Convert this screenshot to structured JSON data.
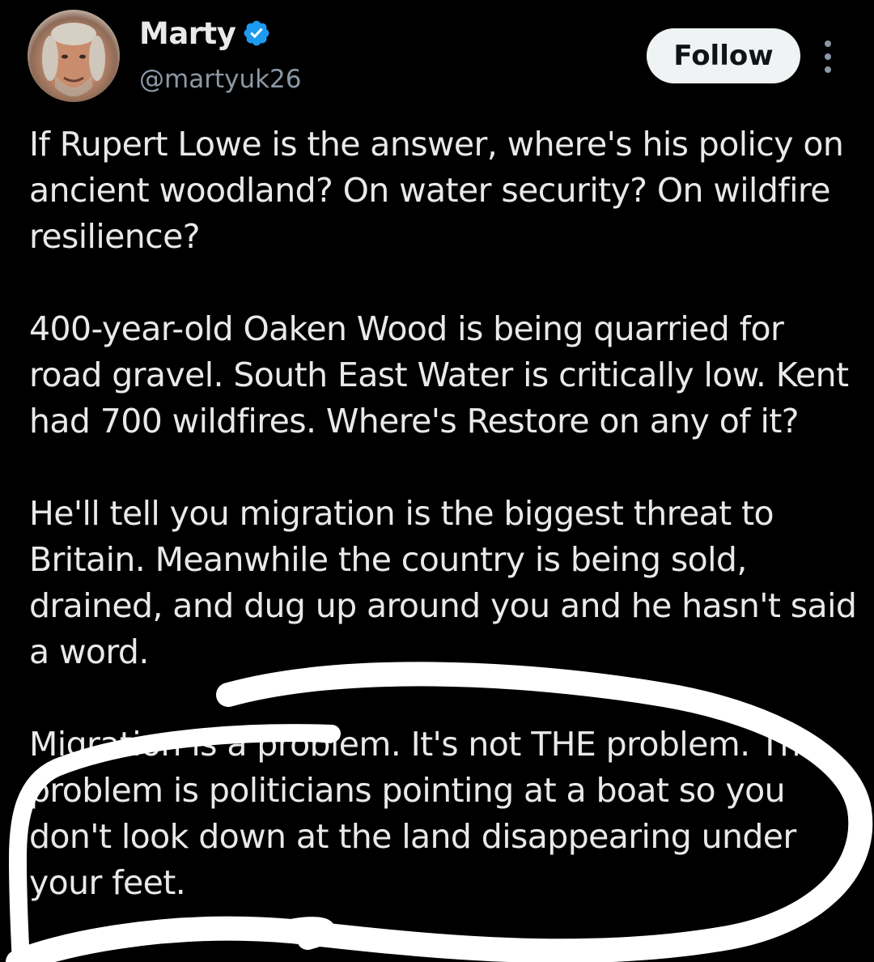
{
  "author": {
    "display_name": "Marty",
    "handle": "@martyuk26",
    "verified": true,
    "verified_icon": "verified-badge-icon",
    "avatar": "profile-photo"
  },
  "actions": {
    "follow_label": "Follow",
    "more_icon": "more-vertical-icon"
  },
  "tweet": {
    "paragraphs": [
      "If Rupert Lowe is the answer, where's his policy on ancient woodland? On water security? On wildfire resilience?",
      "400-year-old Oaken Wood is being quarried for road gravel. South East Water is critically low. Kent had 700 wildfires. Where's Restore on any of it?",
      "He'll tell you migration is the biggest threat to Britain. Meanwhile the country is being sold, drained, and dug up around you and he hasn't said a word.",
      "Migration is a problem. It's not THE problem. The problem is politicians pointing at a boat so you don't look down at the land disappearing under your feet."
    ]
  },
  "colors": {
    "background": "#000000",
    "text": "#e7e9ea",
    "secondary_text": "#8b98a5",
    "verified_blue": "#1d9bf0",
    "follow_bg": "#eff3f4",
    "annotation": "#ffffff"
  }
}
